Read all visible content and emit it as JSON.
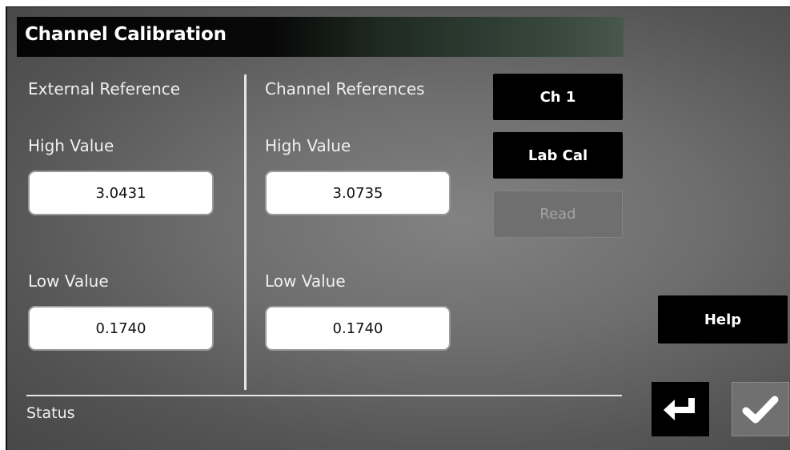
{
  "header": {
    "title": "Channel Calibration"
  },
  "external": {
    "heading": "External Reference",
    "high_label": "High Value",
    "high_value": "3.0431",
    "low_label": "Low Value",
    "low_value": "0.1740"
  },
  "channel": {
    "heading": "Channel References",
    "high_label": "High Value",
    "high_value": "3.0735",
    "low_label": "Low Value",
    "low_value": "0.1740"
  },
  "buttons": {
    "channel": "Ch 1",
    "lab_cal": "Lab Cal",
    "read": "Read",
    "help": "Help"
  },
  "status": {
    "label": "Status"
  },
  "icons": {
    "enter": "enter-return-icon",
    "accept": "checkmark-icon"
  }
}
